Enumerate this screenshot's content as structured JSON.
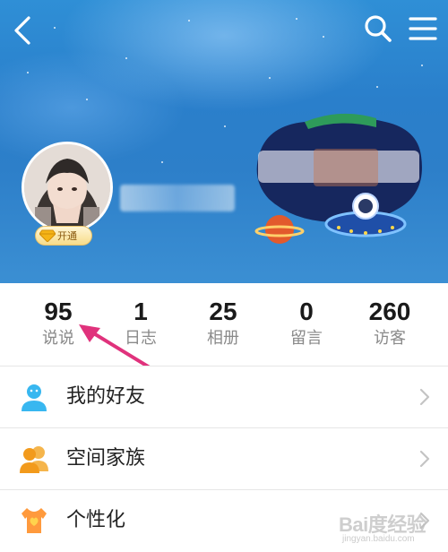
{
  "profile": {
    "vip_label": "开通",
    "nickname": "",
    "header_art": ""
  },
  "stats": [
    {
      "value": "95",
      "label": "说说"
    },
    {
      "value": "1",
      "label": "日志"
    },
    {
      "value": "25",
      "label": "相册"
    },
    {
      "value": "0",
      "label": "留言"
    },
    {
      "value": "260",
      "label": "访客"
    }
  ],
  "menu": [
    {
      "label": "我的好友",
      "icon": "friend-person-icon"
    },
    {
      "label": "空间家族",
      "icon": "family-group-icon"
    },
    {
      "label": "个性化",
      "icon": "personalize-shirt-icon"
    }
  ],
  "icons": {
    "back": "chevron-left-icon",
    "search": "search-icon",
    "menu": "hamburger-menu-icon"
  },
  "colors": {
    "banner": "#2d7fc9",
    "friend_icon": "#38b7f0",
    "family_icon": "#f7a833",
    "personalize_icon": "#ff8a3d",
    "arrow": "#e0327c"
  },
  "watermark": {
    "text": "Bai度经验",
    "sub": "jingyan.baidu.com"
  }
}
